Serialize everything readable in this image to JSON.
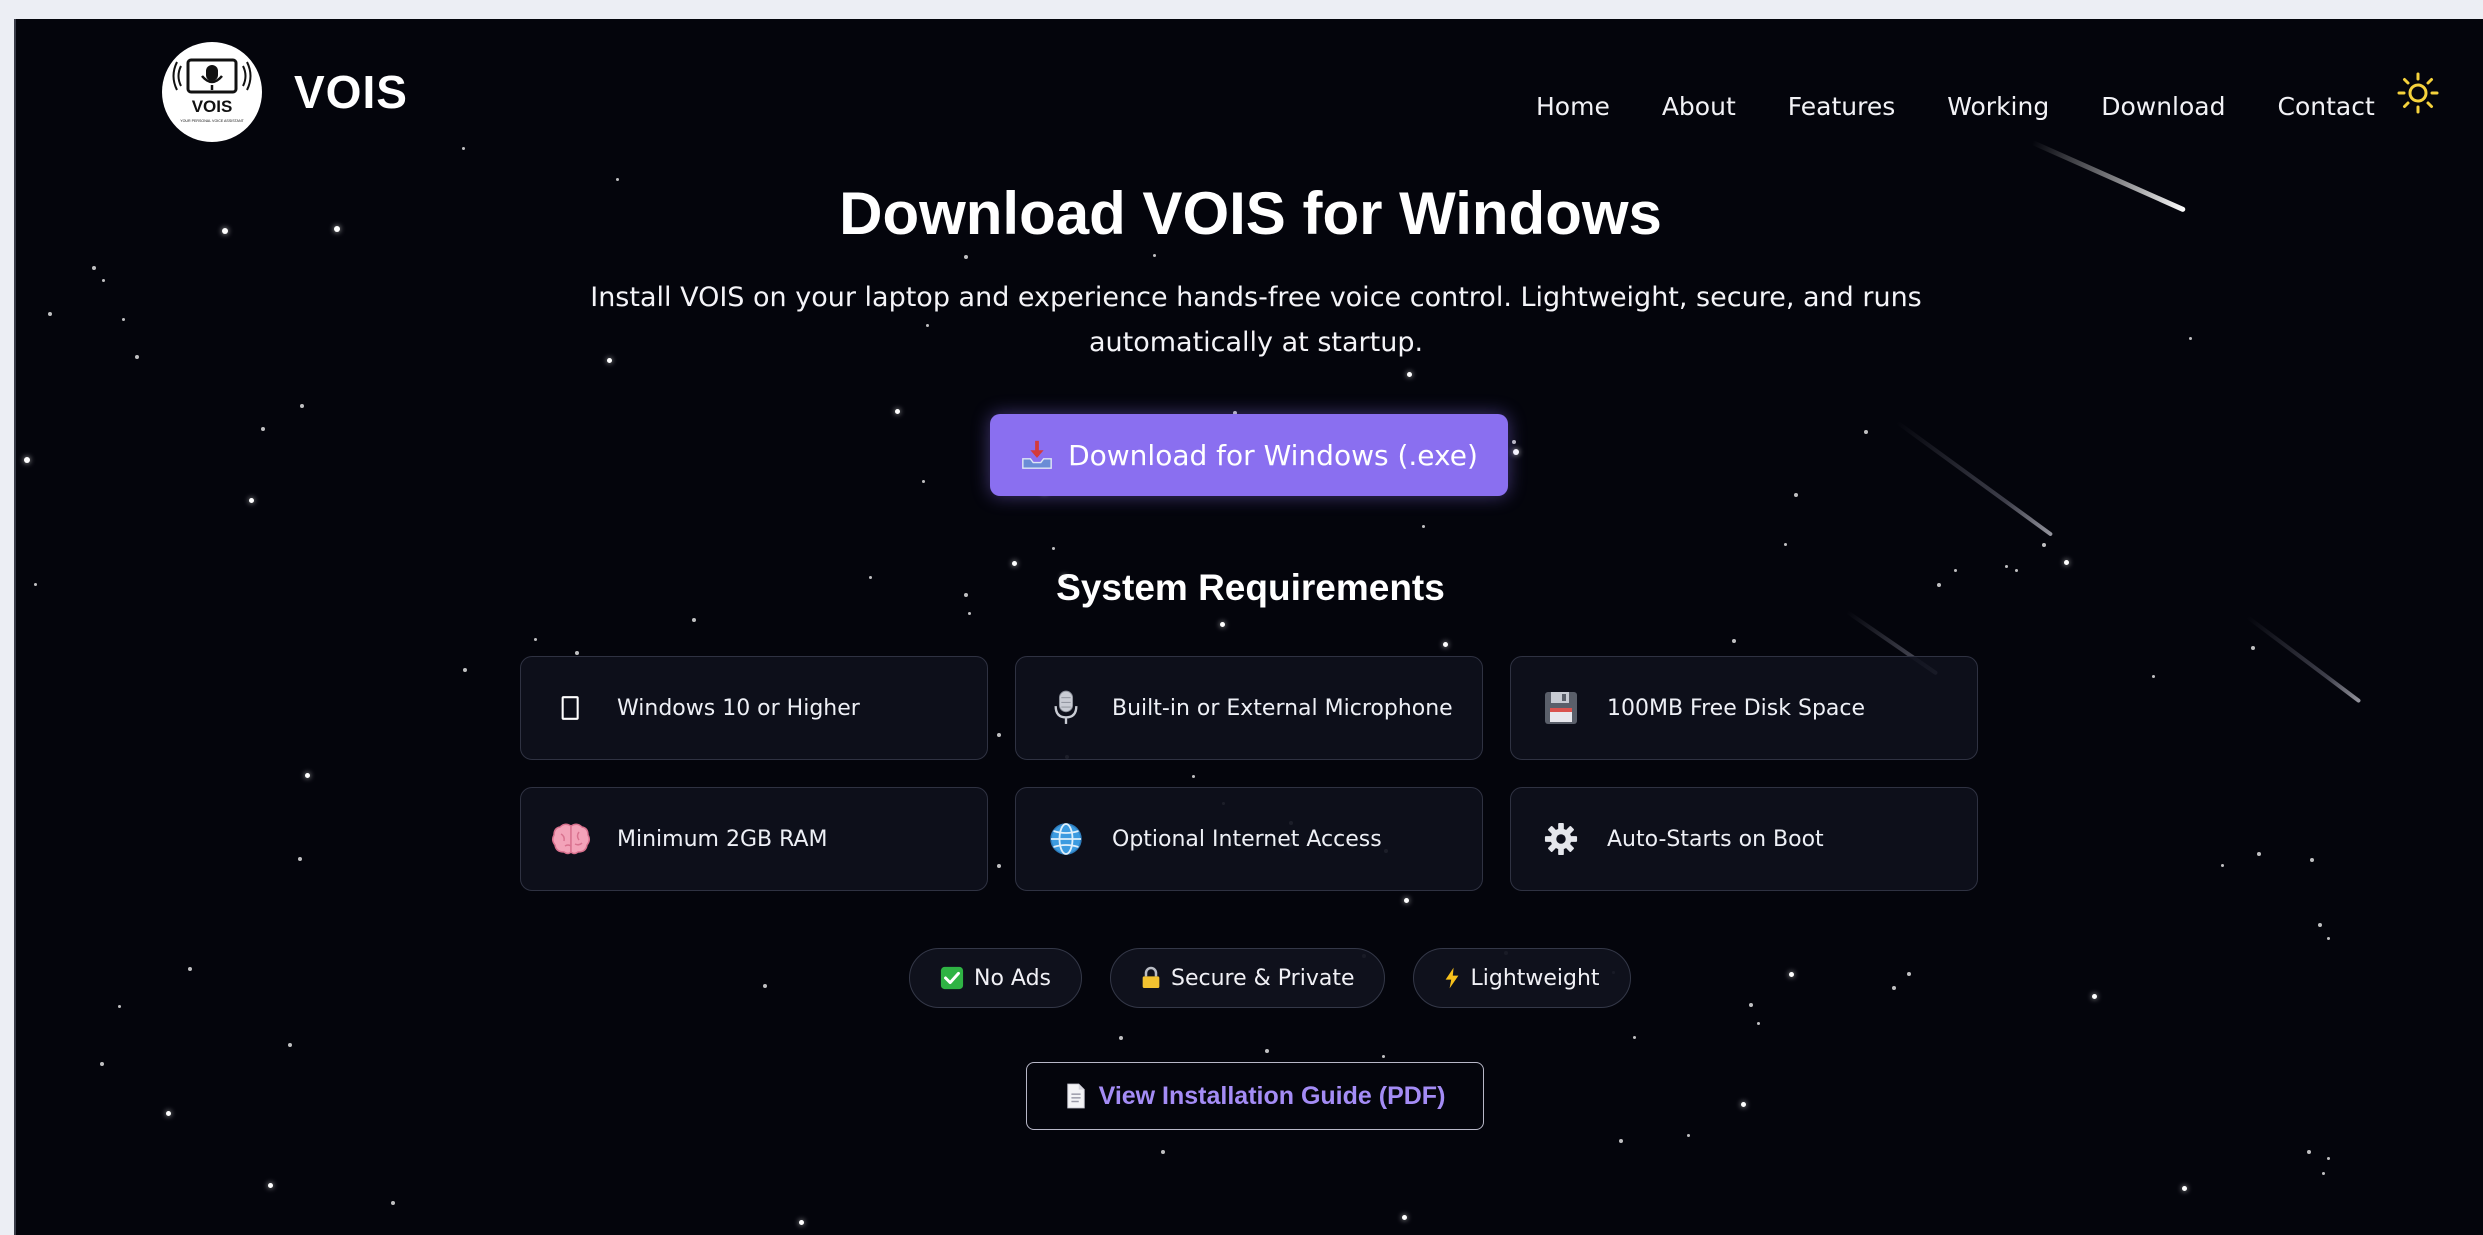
{
  "brand": {
    "name": "VOIS",
    "logo_text": "VOIS",
    "logo_tagline": "YOUR PERSONAL VOICE ASSISTANT"
  },
  "nav": {
    "items": [
      "Home",
      "About",
      "Features",
      "Working",
      "Download",
      "Contact"
    ]
  },
  "theme_toggle": {
    "icon": "sun-icon",
    "color": "#f5d23c"
  },
  "hero": {
    "title": "Download VOIS for Windows",
    "subtitle": "Install VOIS on your laptop and experience hands-free voice control. Lightweight, secure, and runs automatically at startup.",
    "download_button": {
      "label": "Download for Windows (.exe)",
      "icon": "inbox-tray-icon",
      "color": "#8a6ff0"
    }
  },
  "requirements": {
    "title": "System Requirements",
    "items": [
      {
        "label": "Windows 10 or Higher",
        "icon": "window-outline-icon"
      },
      {
        "label": "Built-in or External Microphone",
        "icon": "microphone-icon"
      },
      {
        "label": "100MB Free Disk Space",
        "icon": "floppy-disk-icon"
      },
      {
        "label": "Minimum 2GB RAM",
        "icon": "brain-icon"
      },
      {
        "label": "Optional Internet Access",
        "icon": "globe-icon"
      },
      {
        "label": "Auto-Starts on Boot",
        "icon": "gear-icon"
      }
    ]
  },
  "badges": [
    {
      "label": "No Ads",
      "icon": "check-mark-icon",
      "color": "#2fb344"
    },
    {
      "label": "Secure & Private",
      "icon": "lock-icon",
      "color": "#f2c230"
    },
    {
      "label": "Lightweight",
      "icon": "lightning-icon",
      "color": "#f7c11b"
    }
  ],
  "guide_button": {
    "label": "View Installation Guide (PDF)",
    "icon": "document-icon",
    "color": "#a48cf5"
  }
}
